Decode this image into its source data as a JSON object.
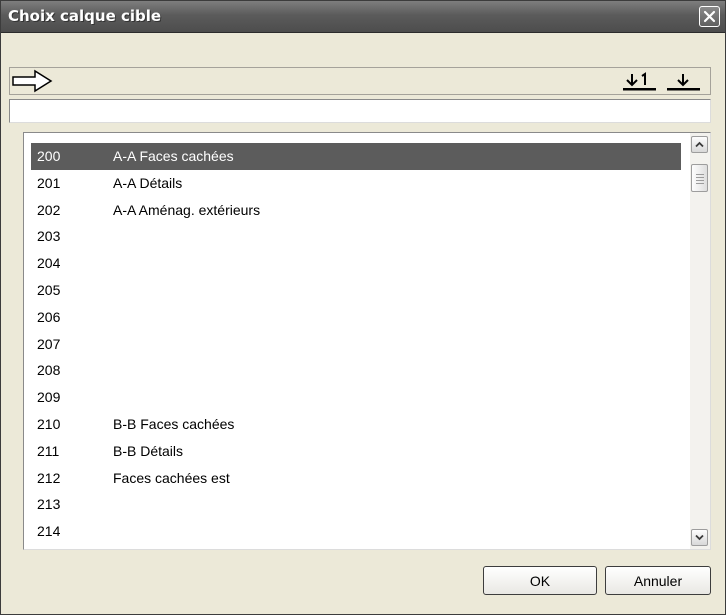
{
  "window": {
    "title": "Choix calque cible"
  },
  "icons": {
    "close": "close-icon",
    "arrow": "right-arrow-icon",
    "load1": "download-1-icon",
    "load": "download-icon",
    "scroll_up": "chevron-up-icon",
    "scroll_down": "chevron-down-icon"
  },
  "path_field": {
    "value": ""
  },
  "layers": [
    {
      "num": "200",
      "name": "A-A Faces cachées",
      "selected": true
    },
    {
      "num": "201",
      "name": "A-A Détails"
    },
    {
      "num": "202",
      "name": "A-A Aménag. extérieurs"
    },
    {
      "num": "203",
      "name": ""
    },
    {
      "num": "204",
      "name": ""
    },
    {
      "num": "205",
      "name": ""
    },
    {
      "num": "206",
      "name": ""
    },
    {
      "num": "207",
      "name": ""
    },
    {
      "num": "208",
      "name": ""
    },
    {
      "num": "209",
      "name": ""
    },
    {
      "num": "210",
      "name": "B-B Faces cachées"
    },
    {
      "num": "211",
      "name": "B-B Détails"
    },
    {
      "num": "212",
      "name": "Faces cachées est"
    },
    {
      "num": "213",
      "name": ""
    },
    {
      "num": "214",
      "name": ""
    }
  ],
  "buttons": {
    "ok": "OK",
    "cancel": "Annuler"
  },
  "colors": {
    "selection": "#5c5c5c",
    "titlebar": "#5b5b5b"
  }
}
